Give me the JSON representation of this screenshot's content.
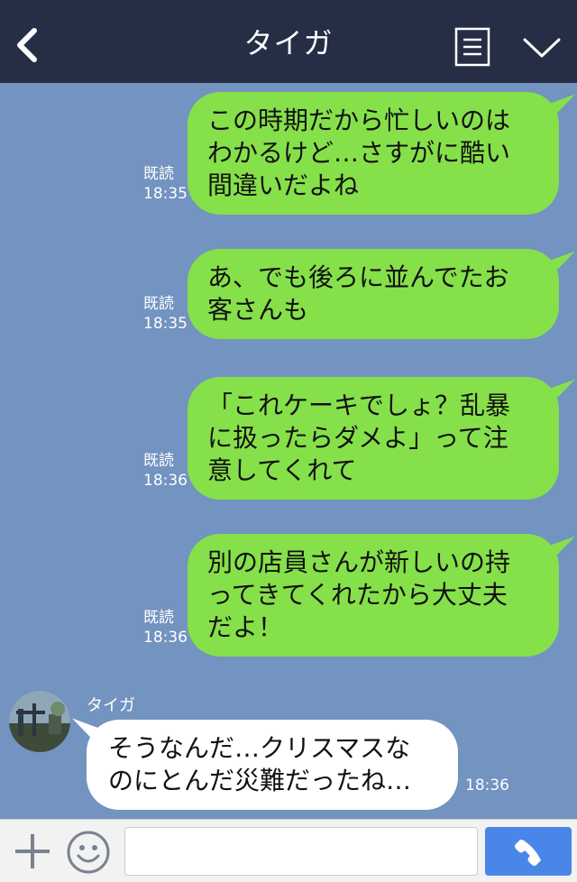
{
  "header": {
    "title": "タイガ",
    "back_icon": "chevron-left-icon",
    "menu_icon": "notes-icon",
    "expand_icon": "chevron-down-icon"
  },
  "colors": {
    "header_bg": "#252e45",
    "chat_bg": "#7393c0",
    "bubble_out": "#86e04a",
    "bubble_in": "#ffffff",
    "call_button": "#4a86e8"
  },
  "messages": [
    {
      "direction": "out",
      "read_label": "既読",
      "time": "18:35",
      "lines": [
        "この時期だから忙しいのは",
        "わかるけど…さすがに酷い",
        "間違いだよね"
      ]
    },
    {
      "direction": "out",
      "read_label": "既読",
      "time": "18:35",
      "lines": [
        "あ、でも後ろに並んでたお",
        "客さんも"
      ]
    },
    {
      "direction": "out",
      "read_label": "既読",
      "time": "18:36",
      "lines": [
        "「これケーキでしょ？乱暴",
        "に扱ったらダメよ」って注",
        "意してくれて"
      ]
    },
    {
      "direction": "out",
      "read_label": "既読",
      "time": "18:36",
      "lines": [
        "別の店員さんが新しいの持",
        "ってきてくれたから大丈夫",
        "だよ！"
      ]
    },
    {
      "direction": "in",
      "sender": "タイガ",
      "time": "18:36",
      "lines": [
        "そうなんだ…クリスマスな",
        "のにとんだ災難だったね…"
      ]
    }
  ],
  "footer": {
    "plus_icon": "plus-icon",
    "emoji_icon": "smiley-icon",
    "input_value": "",
    "call_icon": "phone-icon"
  }
}
